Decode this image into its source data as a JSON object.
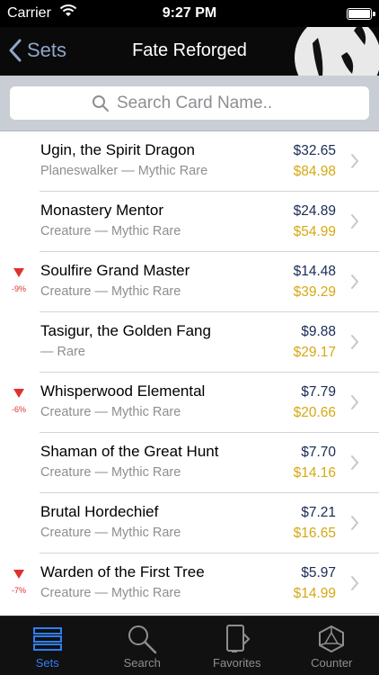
{
  "status": {
    "carrier": "Carrier",
    "time": "9:27 PM"
  },
  "nav": {
    "back_label": "Sets",
    "title": "Fate Reforged"
  },
  "search": {
    "placeholder": "Search Card Name.."
  },
  "cards": [
    {
      "name": "Ugin, the Spirit Dragon",
      "type": "Planeswalker — Mythic Rare",
      "price": "$32.65",
      "foil": "$84.98",
      "trend": ""
    },
    {
      "name": "Monastery Mentor",
      "type": "Creature — Mythic Rare",
      "price": "$24.89",
      "foil": "$54.99",
      "trend": ""
    },
    {
      "name": "Soulfire Grand Master",
      "type": "Creature — Mythic Rare",
      "price": "$14.48",
      "foil": "$39.29",
      "trend": "-9%"
    },
    {
      "name": "Tasigur, the Golden Fang",
      "type": " — Rare",
      "price": "$9.88",
      "foil": "$29.17",
      "trend": ""
    },
    {
      "name": "Whisperwood Elemental",
      "type": "Creature — Mythic Rare",
      "price": "$7.79",
      "foil": "$20.66",
      "trend": "-6%"
    },
    {
      "name": "Shaman of the Great Hunt",
      "type": "Creature — Mythic Rare",
      "price": "$7.70",
      "foil": "$14.16",
      "trend": ""
    },
    {
      "name": "Brutal Hordechief",
      "type": "Creature — Mythic Rare",
      "price": "$7.21",
      "foil": "$16.65",
      "trend": ""
    },
    {
      "name": "Warden of the First Tree",
      "type": "Creature — Mythic Rare",
      "price": "$5.97",
      "foil": "$14.99",
      "trend": "-7%"
    }
  ],
  "tabs": [
    {
      "label": "Sets",
      "icon": "sets-icon",
      "active": true
    },
    {
      "label": "Search",
      "icon": "search-icon",
      "active": false
    },
    {
      "label": "Favorites",
      "icon": "favorites-icon",
      "active": false
    },
    {
      "label": "Counter",
      "icon": "counter-icon",
      "active": false
    }
  ],
  "colors": {
    "accent": "#2f7ef6",
    "price": "#1a2b55",
    "foil": "#d6a812",
    "trend_down": "#e0322d"
  }
}
